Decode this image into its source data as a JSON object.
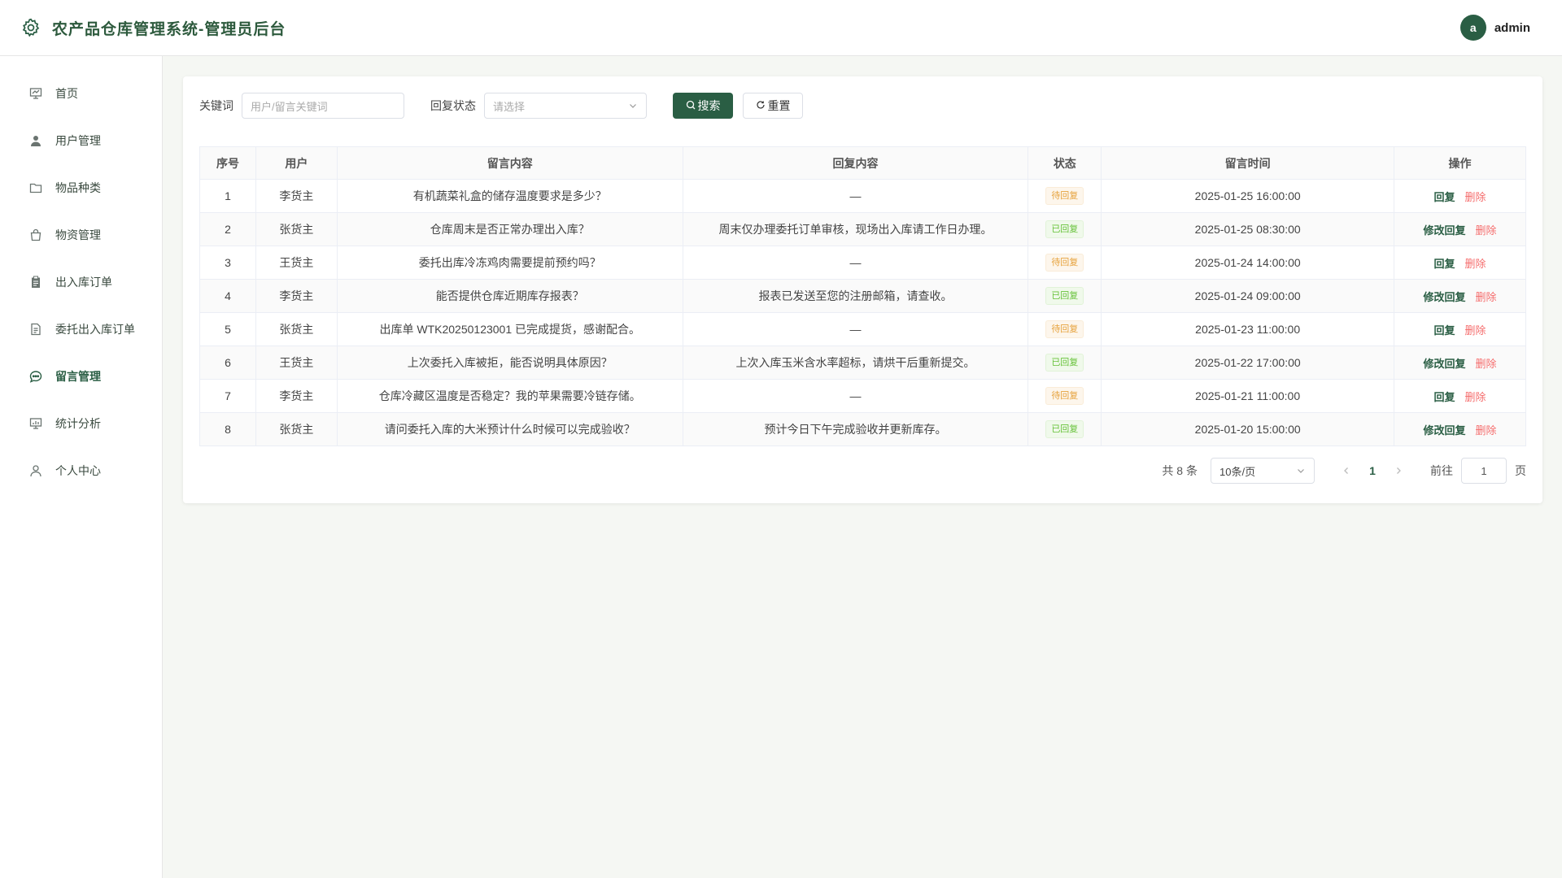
{
  "app": {
    "title": "农产品仓库管理系统-管理员后台",
    "logo_icon": "gear-icon"
  },
  "user": {
    "avatar": "a",
    "name": "admin"
  },
  "sidebar": {
    "items": [
      {
        "label": "首页",
        "icon": "presentation-icon"
      },
      {
        "label": "用户管理",
        "icon": "user-icon"
      },
      {
        "label": "物品种类",
        "icon": "folder-icon"
      },
      {
        "label": "物资管理",
        "icon": "bag-icon"
      },
      {
        "label": "出入库订单",
        "icon": "clipboard-icon"
      },
      {
        "label": "委托出入库订单",
        "icon": "document-icon"
      },
      {
        "label": "留言管理",
        "icon": "chat-icon",
        "active": true
      },
      {
        "label": "统计分析",
        "icon": "chart-board-icon"
      },
      {
        "label": "个人中心",
        "icon": "person-icon"
      }
    ]
  },
  "filters": {
    "keyword_label": "关键词",
    "keyword_placeholder": "用户/留言关键词",
    "status_label": "回复状态",
    "status_placeholder": "请选择",
    "search_button": "搜索",
    "reset_button": "重置"
  },
  "table": {
    "headers": [
      "序号",
      "用户",
      "留言内容",
      "回复内容",
      "状态",
      "留言时间",
      "操作"
    ],
    "rows": [
      {
        "no": "1",
        "user": "李货主",
        "message": "有机蔬菜礼盒的储存温度要求是多少？",
        "reply": "—",
        "status": "待回复",
        "time": "2025-01-25 16:00:00",
        "action": "回复",
        "delete": "删除"
      },
      {
        "no": "2",
        "user": "张货主",
        "message": "仓库周末是否正常办理出入库？",
        "reply": "周末仅办理委托订单审核，现场出入库请工作日办理。",
        "status": "已回复",
        "time": "2025-01-25 08:30:00",
        "action": "修改回复",
        "delete": "删除"
      },
      {
        "no": "3",
        "user": "王货主",
        "message": "委托出库冷冻鸡肉需要提前预约吗？",
        "reply": "—",
        "status": "待回复",
        "time": "2025-01-24 14:00:00",
        "action": "回复",
        "delete": "删除"
      },
      {
        "no": "4",
        "user": "李货主",
        "message": "能否提供仓库近期库存报表？",
        "reply": "报表已发送至您的注册邮箱，请查收。",
        "status": "已回复",
        "time": "2025-01-24 09:00:00",
        "action": "修改回复",
        "delete": "删除"
      },
      {
        "no": "5",
        "user": "张货主",
        "message": "出库单 WTK20250123001 已完成提货，感谢配合。",
        "reply": "—",
        "status": "待回复",
        "time": "2025-01-23 11:00:00",
        "action": "回复",
        "delete": "删除"
      },
      {
        "no": "6",
        "user": "王货主",
        "message": "上次委托入库被拒，能否说明具体原因？",
        "reply": "上次入库玉米含水率超标，请烘干后重新提交。",
        "status": "已回复",
        "time": "2025-01-22 17:00:00",
        "action": "修改回复",
        "delete": "删除"
      },
      {
        "no": "7",
        "user": "李货主",
        "message": "仓库冷藏区温度是否稳定？我的苹果需要冷链存储。",
        "reply": "—",
        "status": "待回复",
        "time": "2025-01-21 11:00:00",
        "action": "回复",
        "delete": "删除"
      },
      {
        "no": "8",
        "user": "张货主",
        "message": "请问委托入库的大米预计什么时候可以完成验收？",
        "reply": "预计今日下午完成验收并更新库存。",
        "status": "已回复",
        "time": "2025-01-20 15:00:00",
        "action": "修改回复",
        "delete": "删除"
      }
    ]
  },
  "pagination": {
    "total": "共 8 条",
    "page_size": "10条/页",
    "current_page": "1",
    "goto_label": "前往",
    "goto_value": "1",
    "page_unit": "页"
  },
  "colors": {
    "primary": "#2a5e44",
    "danger": "#f56c6c",
    "pending": "#e6a23c",
    "done": "#67c23a"
  }
}
